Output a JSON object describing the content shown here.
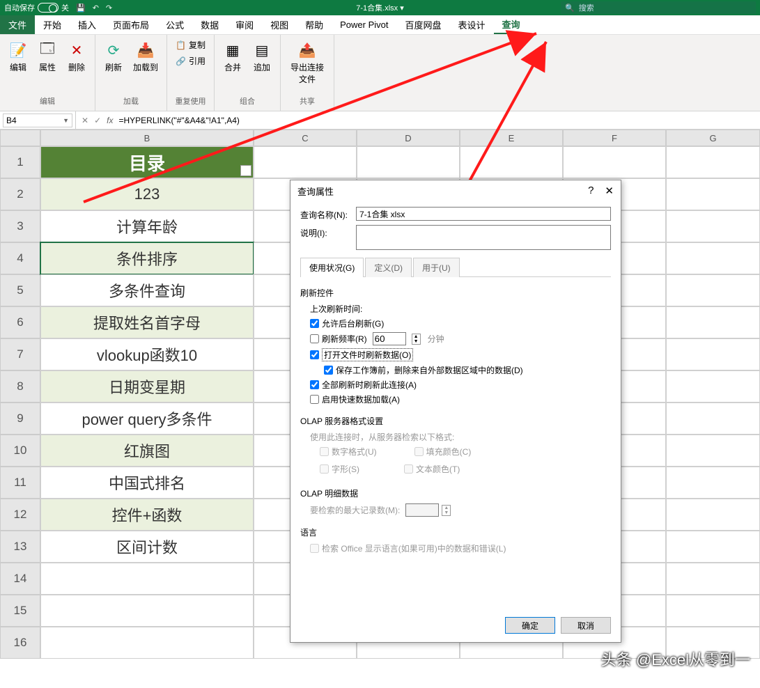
{
  "titlebar": {
    "autosave": "自动保存",
    "off": "关",
    "filename": "7-1合集.xlsx ▾",
    "search_placeholder": "搜索"
  },
  "menu": {
    "file": "文件",
    "home": "开始",
    "insert": "插入",
    "layout": "页面布局",
    "formula": "公式",
    "data": "数据",
    "review": "审阅",
    "view": "视图",
    "help": "帮助",
    "pp": "Power Pivot",
    "baidu": "百度网盘",
    "design": "表设计",
    "query": "查询"
  },
  "ribbon": {
    "edit": {
      "edit": "编辑",
      "prop": "属性",
      "del": "删除",
      "group": "编辑"
    },
    "load": {
      "refresh": "刷新",
      "loadto": "加载到",
      "group": "加载"
    },
    "reuse": {
      "copy": "复制",
      "ref": "引用",
      "group": "重复使用"
    },
    "combine": {
      "merge": "合并",
      "append": "追加",
      "group": "组合"
    },
    "share": {
      "export": "导出连接文件",
      "group": "共享"
    }
  },
  "formulabar": {
    "cell": "B4",
    "formula": "=HYPERLINK(\"#\"&A4&\"!A1\",A4)"
  },
  "columns": [
    "B",
    "C",
    "D",
    "E",
    "F",
    "G"
  ],
  "colB_header": "目录",
  "rows": [
    "123",
    "计算年龄",
    "条件排序",
    "多条件查询",
    "提取姓名首字母",
    "vlookup函数10",
    "日期变星期",
    "power query多条件",
    "红旗图",
    "中国式排名",
    "控件+函数",
    "区间计数"
  ],
  "rownums": [
    1,
    2,
    3,
    4,
    5,
    6,
    7,
    8,
    9,
    10,
    11,
    12,
    13,
    14,
    15,
    16
  ],
  "dialog": {
    "title": "查询属性",
    "name_label": "查询名称(N):",
    "name_value": "7-1合集 xlsx",
    "desc_label": "说明(I):",
    "tabs": {
      "usage": "使用状况(G)",
      "def": "定义(D)",
      "usedin": "用于(U)"
    },
    "refresh_section": "刷新控件",
    "last_refresh": "上次刷新时间:",
    "allow_bg": "允许后台刷新(G)",
    "refresh_freq": "刷新频率(R)",
    "refresh_freq_val": "60",
    "minutes": "分钟",
    "refresh_open": "打开文件时刷新数据(O)",
    "del_query": "保存工作簿前，删除来自外部数据区域中的数据(D)",
    "refresh_all": "全部刷新时刷新此连接(A)",
    "fast_load": "启用快速数据加载(A)",
    "olap_fmt": "OLAP 服务器格式设置",
    "olap_fmt_desc": "使用此连接时，从服务器检索以下格式:",
    "num_fmt": "数字格式(U)",
    "fill": "填充颜色(C)",
    "font": "字形(S)",
    "text_color": "文本颜色(T)",
    "olap_detail": "OLAP 明细数据",
    "max_records": "要检索的最大记录数(M):",
    "lang_section": "语言",
    "lang_opt": "检索 Office 显示语言(如果可用)中的数据和错误(L)",
    "ok": "确定",
    "cancel": "取消"
  },
  "watermark": "头条 @Excel从零到一"
}
